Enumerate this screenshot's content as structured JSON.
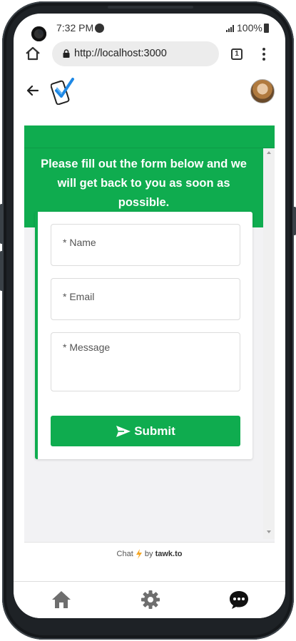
{
  "status_bar": {
    "time": "7:32 PM",
    "battery": "100%"
  },
  "browser": {
    "url": "http://localhost:3000",
    "tab_count": "1"
  },
  "widget": {
    "header_text": "Please fill out the form below and we will get back to you as soon as possible.",
    "fields": {
      "name_placeholder": "* Name",
      "email_placeholder": "* Email",
      "message_placeholder": "* Message"
    },
    "submit_label": "Submit",
    "footer": {
      "prefix": "Chat",
      "by": "by",
      "brand": "tawk.to"
    },
    "accent_color": "#0fac4f"
  },
  "bottom_nav": {
    "items": [
      "home-icon",
      "gear-icon",
      "chat-icon"
    ]
  }
}
